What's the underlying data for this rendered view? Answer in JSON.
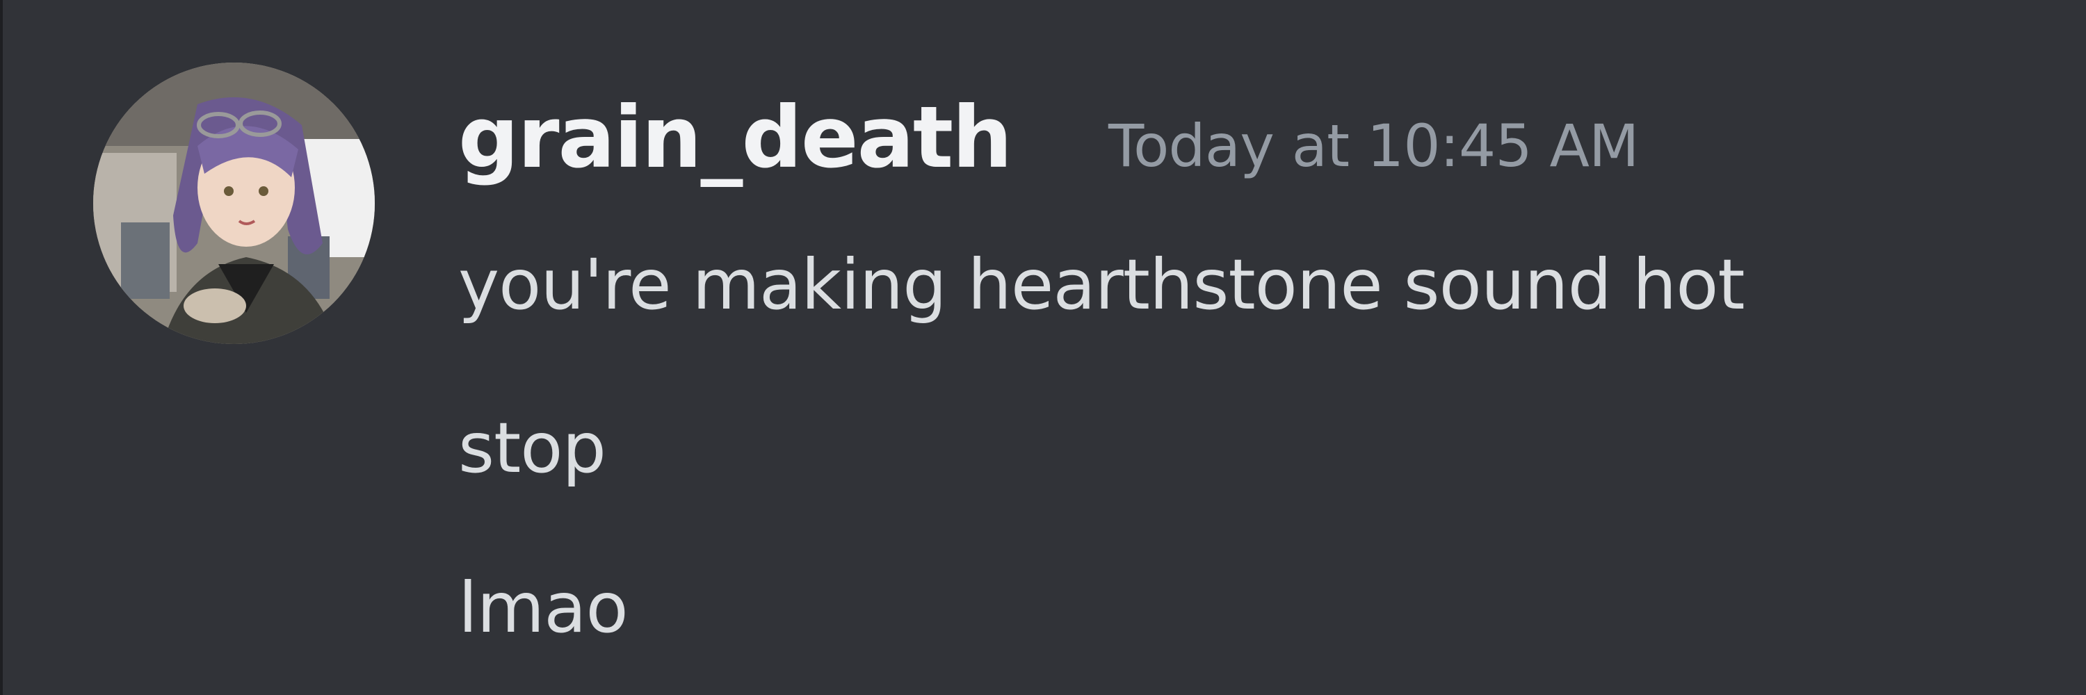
{
  "message": {
    "username": "grain_death",
    "timestamp": "Today at 10:45 AM",
    "avatar_icon": "user-avatar",
    "lines": [
      "you're making hearthstone sound hot",
      "stop",
      "lmao"
    ]
  },
  "colors": {
    "background": "#313338",
    "username": "#f2f3f5",
    "timestamp": "#949ba4",
    "message_text": "#dbdee1"
  }
}
